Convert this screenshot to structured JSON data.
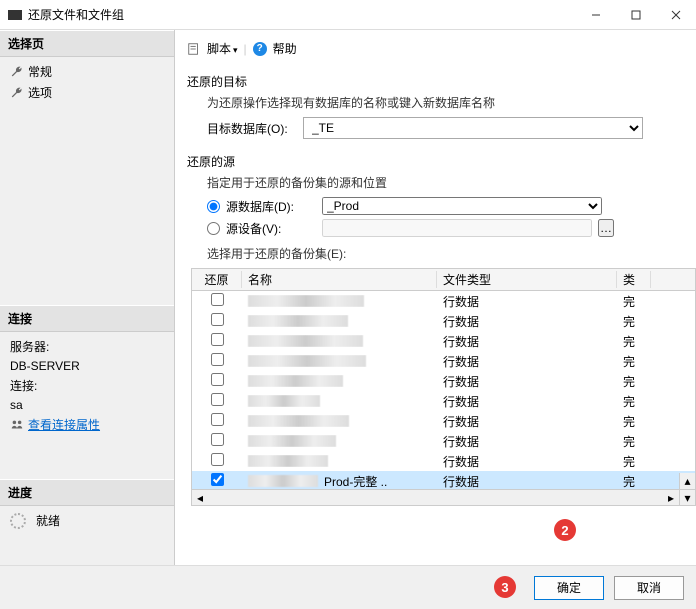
{
  "window": {
    "title": "还原文件和文件组"
  },
  "sidebar": {
    "select_header": "选择页",
    "items": [
      "常规",
      "选项"
    ],
    "conn_header": "连接",
    "server_label": "服务器:",
    "server_value": "DB-SERVER",
    "conn_label": "连接:",
    "conn_value": "sa",
    "view_props": "查看连接属性",
    "progress_header": "进度",
    "progress_status": "就绪"
  },
  "toolbar": {
    "script": "脚本",
    "help": "帮助"
  },
  "dest": {
    "title": "还原的目标",
    "subtitle": "为还原操作选择现有数据库的名称或键入新数据库名称",
    "db_label": "目标数据库(O):",
    "db_value": "_TE"
  },
  "source": {
    "title": "还原的源",
    "subtitle": "指定用于还原的备份集的源和位置",
    "radio_db": "源数据库(D):",
    "db_value": "_Prod",
    "radio_dev": "源设备(V):",
    "select_sets": "选择用于还原的备份集(E):"
  },
  "table": {
    "headers": {
      "restore": "还原",
      "name": "名称",
      "type": "文件类型",
      "category": "类"
    },
    "rows": [
      {
        "checked": false,
        "name": "",
        "type": "行数据",
        "cat": "完"
      },
      {
        "checked": false,
        "name": "",
        "type": "行数据",
        "cat": "完"
      },
      {
        "checked": false,
        "name": "",
        "type": "行数据",
        "cat": "完"
      },
      {
        "checked": false,
        "name": "",
        "type": "行数据",
        "cat": "完"
      },
      {
        "checked": false,
        "name": "",
        "type": "行数据",
        "cat": "完"
      },
      {
        "checked": false,
        "name": "",
        "type": "行数据",
        "cat": "完"
      },
      {
        "checked": false,
        "name": "",
        "type": "行数据",
        "cat": "完"
      },
      {
        "checked": false,
        "name": "",
        "type": "行数据",
        "cat": "完"
      },
      {
        "checked": false,
        "name": "",
        "type": "行数据",
        "cat": "完"
      },
      {
        "checked": true,
        "name": "Prod-完整 ..",
        "type": "行数据",
        "cat": "完",
        "selected": true
      }
    ]
  },
  "footer": {
    "ok": "确定",
    "cancel": "取消"
  },
  "badges": {
    "b2": "2",
    "b3": "3"
  }
}
